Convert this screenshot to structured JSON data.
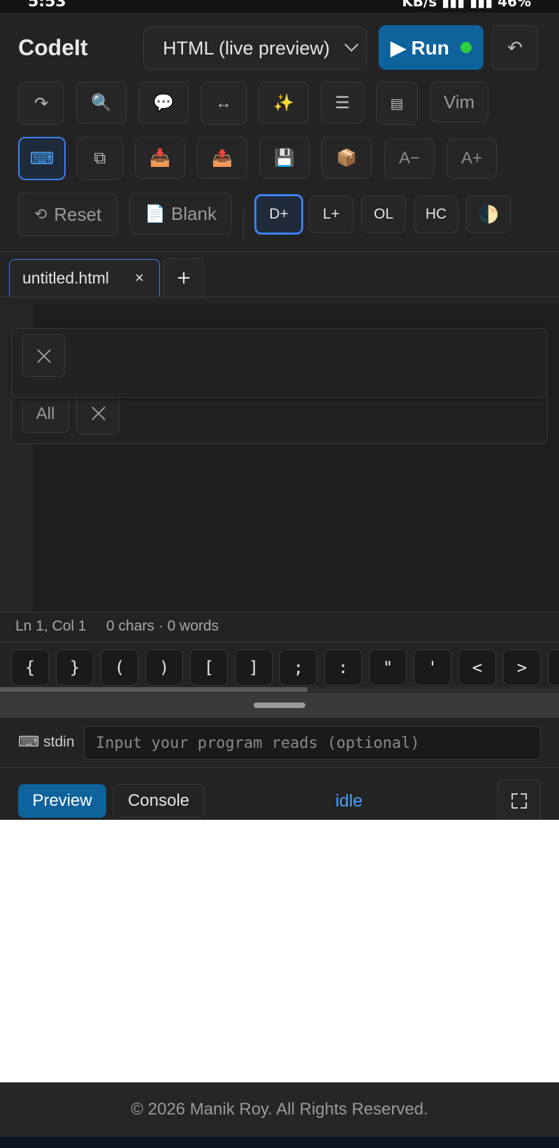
{
  "status_bar": {
    "time": "5:53",
    "indicators": "KB/s ▮▮▮ ▮▮▮ 46%"
  },
  "header": {
    "app_title": "CodeIt",
    "language_select": "HTML (live preview)",
    "run_label": "▶ Run",
    "undo_icon": "undo-icon"
  },
  "toolbar": {
    "row1": [
      "redo-icon",
      "search-icon",
      "comment-icon",
      "swap-icon",
      "sparkle-icon",
      "menu-icon",
      "panel-icon"
    ],
    "vim_label": "Vim",
    "row2_icons": [
      "keyboard-icon",
      "copy-icon",
      "inbox-icon",
      "outbox-icon",
      "floppy-icon",
      "package-icon"
    ],
    "font_minus": "A−",
    "font_plus": "A+",
    "reset_label": "Reset",
    "blank_label": "Blank",
    "d_plus": "D+",
    "l_plus": "L+",
    "ol": "OL",
    "hc": "HC",
    "glyphs": {
      "redo": "↷",
      "search": "🔍",
      "comment": "💬",
      "swap": "↔",
      "sparkle": "✨",
      "menu": "☰",
      "panel": "▤",
      "keyboard": "⌨",
      "copy": "⧉",
      "inbox": "📥",
      "outbox": "📤",
      "floppy": "💾",
      "package": "📦",
      "reset": "⟲",
      "blank": "📄",
      "theme": "🌓",
      "undo": "↶"
    }
  },
  "tabs": {
    "file_name": "untitled.html",
    "close": "×",
    "add": "+"
  },
  "find_panel": {
    "all_label": "All"
  },
  "editor_status": {
    "position": "Ln 1, Col 1",
    "counts": "0 chars · 0 words"
  },
  "quick_keys": [
    "{",
    "}",
    "(",
    ")",
    "[",
    "]",
    ";",
    ":",
    "\"",
    "'",
    "<",
    ">"
  ],
  "stdin": {
    "label": "⌨ stdin",
    "placeholder": "Input your program reads (optional)"
  },
  "output": {
    "preview_tab": "Preview",
    "console_tab": "Console",
    "status": "idle"
  },
  "footer": {
    "copyright": "© 2026 Manik Roy. All Rights Reserved."
  },
  "colors": {
    "accent": "#0e639c",
    "selected_border": "#3b82f6",
    "status_idle": "#4aa3ff",
    "run_dot": "#2ecc40"
  }
}
